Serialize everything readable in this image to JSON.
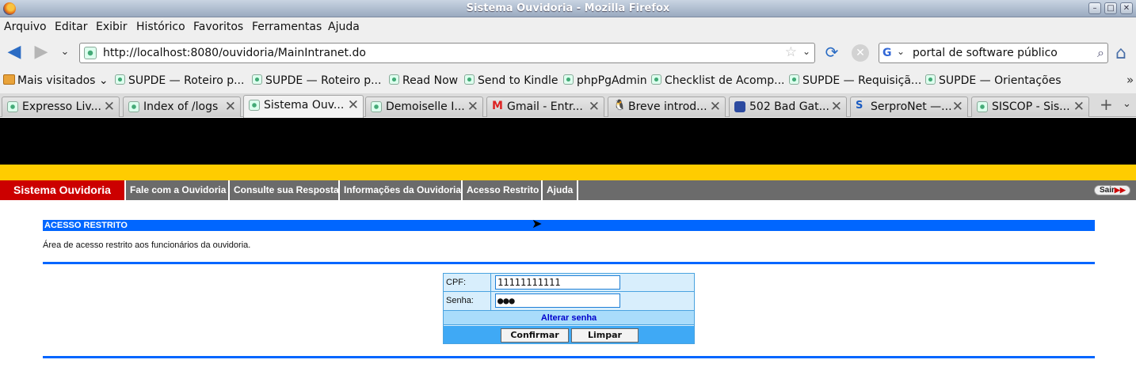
{
  "window": {
    "title": "Sistema Ouvidoria - Mozilla Firefox"
  },
  "menu": [
    "Arquivo",
    "Editar",
    "Exibir",
    "Histórico",
    "Favoritos",
    "Ferramentas",
    "Ajuda"
  ],
  "nav": {
    "url": "http://localhost:8080/ouvidoria/MainIntranet.do",
    "search_query": "portal de software público"
  },
  "bookmarks": {
    "most_visited": "Mais visitados",
    "items": [
      "SUPDE — Roteiro p...",
      "SUPDE — Roteiro p...",
      "Read Now",
      "Send to Kindle",
      "phpPgAdmin",
      "Checklist de Acomp...",
      "SUPDE — Requisiçã...",
      "SUPDE — Orientações"
    ]
  },
  "tabs": [
    {
      "label": "Expresso Liv..."
    },
    {
      "label": "Index of /logs"
    },
    {
      "label": "Sistema Ouv..."
    },
    {
      "label": "Demoiselle I..."
    },
    {
      "label": "Gmail - Entr..."
    },
    {
      "label": "Breve introd..."
    },
    {
      "label": "502 Bad Gat..."
    },
    {
      "label": "SerproNet —..."
    },
    {
      "label": "SISCOP - Sis..."
    }
  ],
  "site": {
    "brand": "Sistema Ouvidoria",
    "links": [
      "Fale com a Ouvidoria",
      "Consulte sua Resposta",
      "Informações da Ouvidoria",
      "Acesso Restrito",
      "Ajuda"
    ],
    "logout": "Sair"
  },
  "section": {
    "header": "ACESSO RESTRITO",
    "description": "Área de acesso restrito aos funcionários da ouvidoria."
  },
  "login": {
    "cpf_label": "CPF:",
    "cpf_value": "11111111111",
    "senha_label": "Senha:",
    "senha_value": "●●●",
    "change_password": "Alterar senha",
    "confirm": "Confirmar",
    "clear": "Limpar"
  },
  "colors": {
    "brand_red": "#cc0000",
    "accent_yellow": "#ffcc00",
    "section_blue": "#0066ff"
  }
}
